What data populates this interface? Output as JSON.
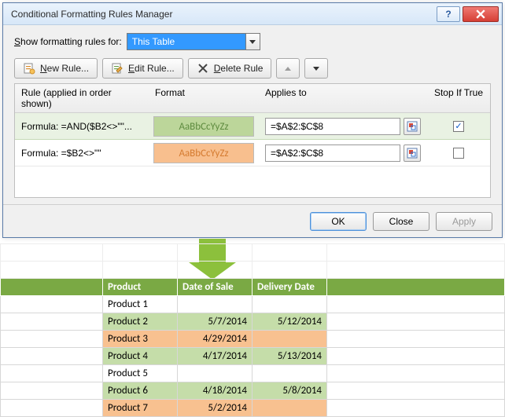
{
  "dialog": {
    "title": "Conditional Formatting Rules Manager",
    "show_label_pre": "S",
    "show_label_post": "how formatting rules for:",
    "show_value": "This Table",
    "toolbar": {
      "new_pre": "N",
      "new_post": "ew Rule...",
      "edit_pre": "E",
      "edit_post": "dit Rule...",
      "delete_pre": "D",
      "delete_post": "elete Rule"
    },
    "columns": {
      "rule": "Rule (applied in order shown)",
      "format": "Format",
      "applies": "Applies to",
      "stop": "Stop If True"
    },
    "rules": [
      {
        "formula": "Formula: =AND($B2<>\"\"...",
        "preview_text": "AaBbCcYyZz",
        "preview_bg": "#bcd69a",
        "preview_fg": "#5e8b3f",
        "applies": "=$A$2:$C$8",
        "stop_checked": true,
        "selected": true
      },
      {
        "formula": "Formula: =$B2<>\"\"",
        "preview_text": "AaBbCcYyZz",
        "preview_bg": "#f8bf8e",
        "preview_fg": "#d57b30",
        "applies": "=$A$2:$C$8",
        "stop_checked": false,
        "selected": false
      }
    ],
    "buttons": {
      "ok": "OK",
      "close": "Close",
      "apply": "Apply"
    }
  },
  "chart_data": {
    "type": "table",
    "headers": [
      "Product",
      "Date of Sale",
      "Delivery Date"
    ],
    "rows": [
      {
        "product": "Product 1",
        "sale": "",
        "delivery": "",
        "band": "none"
      },
      {
        "product": "Product 2",
        "sale": "5/7/2014",
        "delivery": "5/12/2014",
        "band": "green"
      },
      {
        "product": "Product 3",
        "sale": "4/29/2014",
        "delivery": "",
        "band": "orange"
      },
      {
        "product": "Product 4",
        "sale": "4/17/2014",
        "delivery": "5/13/2014",
        "band": "green"
      },
      {
        "product": "Product 5",
        "sale": "",
        "delivery": "",
        "band": "none"
      },
      {
        "product": "Product 6",
        "sale": "4/18/2014",
        "delivery": "5/8/2014",
        "band": "green"
      },
      {
        "product": "Product 7",
        "sale": "5/2/2014",
        "delivery": "",
        "band": "orange"
      }
    ],
    "colors": {
      "green": "#c5dda9",
      "orange": "#f8c190",
      "header": "#7aa944"
    }
  }
}
